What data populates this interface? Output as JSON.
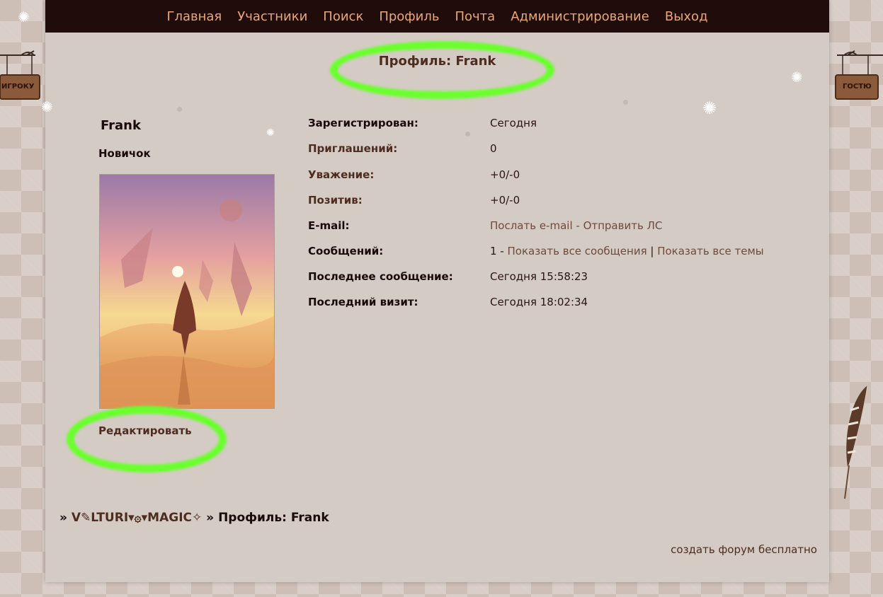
{
  "nav": {
    "items": [
      {
        "label": "Главная"
      },
      {
        "label": "Участники"
      },
      {
        "label": "Поиск"
      },
      {
        "label": "Профиль"
      },
      {
        "label": "Почта"
      },
      {
        "label": "Администрирование"
      },
      {
        "label": "Выход"
      }
    ]
  },
  "page_title": "Профиль: Frank",
  "user": {
    "name": "Frank",
    "rank": "Новичок",
    "edit_label": "Редактировать"
  },
  "info": {
    "registered": {
      "label": "Зарегистрирован:",
      "value": "Сегодня"
    },
    "invites": {
      "label": "Приглашений:",
      "value": "0"
    },
    "respect": {
      "label": "Уважение:",
      "value": "+0/-0"
    },
    "positive": {
      "label": "Позитив:",
      "value": "+0/-0"
    },
    "email": {
      "label": "E-mail:",
      "link1": "Послать e-mail",
      "sep": " - ",
      "link2": "Отправить ЛС"
    },
    "posts": {
      "label": "Сообщений:",
      "count": "1",
      "sep1": " - ",
      "link1": "Показать все сообщения",
      "sep2": " | ",
      "link2": "Показать все темы"
    },
    "last_post": {
      "label": "Последнее сообщение:",
      "value": "Сегодня 15:58:23"
    },
    "last_visit": {
      "label": "Последний визит:",
      "value": "Сегодня 18:02:34"
    }
  },
  "breadcrumb": {
    "prefix": "» ",
    "forum": "V✎LTURI▾۞▾MAGIC✧",
    "sep": " » ",
    "current": "Профиль: Frank"
  },
  "footer": {
    "link": "создать форум бесплатно"
  },
  "signs": {
    "left": "ИГРОКУ",
    "right": "ГОСТЮ"
  },
  "colors": {
    "nav_bg": "#200c0a",
    "nav_text": "#e8a878",
    "highlight": "#6bff2e",
    "panel_bg": "#d4cbc4"
  }
}
